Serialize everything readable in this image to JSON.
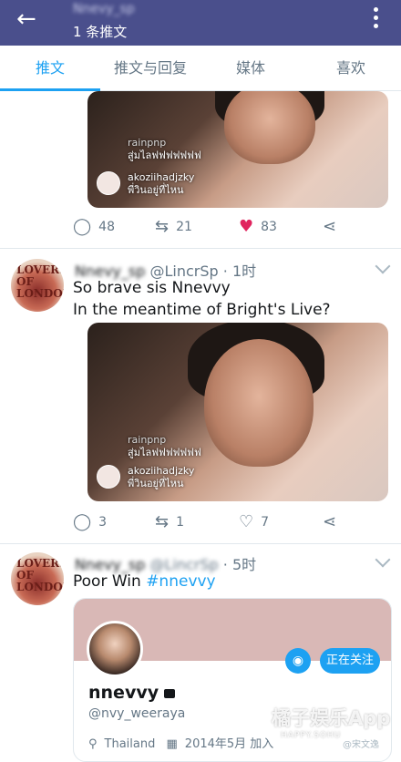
{
  "appbar": {
    "back_icon": "arrow-left-icon",
    "name": "Nnevy_sp",
    "subtitle": "1 条推文",
    "more_icon": "more-vertical-icon",
    "color": "#4a4f8c"
  },
  "tabs": [
    {
      "label": "推文",
      "active": true
    },
    {
      "label": "推文与回复",
      "active": false
    },
    {
      "label": "媒体",
      "active": false
    },
    {
      "label": "喜欢",
      "active": false
    }
  ],
  "accent": "#1da1f2",
  "tweet0": {
    "overlay_user": "rainpnp",
    "overlay_comment_user": "akoziihadjzky",
    "overlay_comment": "พี่วินอยู่ที่ไหน",
    "overlay_line1": "สู่มไลฟฟฟฟฟฟฟ",
    "replies": "48",
    "retweets": "21",
    "likes": "83",
    "liked": true
  },
  "tweet1": {
    "name": "Nnevy_sp",
    "handle": "@LincrSp",
    "time": "· 1时",
    "text_line1": "So brave sis Nnevvy",
    "text_line2": "In the meantime of Bright's Live?",
    "overlay_user": "rainpnp",
    "overlay_line1": "สู่มไลฟฟฟฟฟฟฟ",
    "overlay_comment_user": "akoziihadjzky",
    "overlay_comment": "พี่วินอยู่ที่ไหน",
    "replies": "3",
    "retweets": "1",
    "likes": "7"
  },
  "tweet2": {
    "name": "Nnevy_sp",
    "handle": "@LincrSp",
    "time": "· 5时",
    "text_prefix": "Poor Win ",
    "hashtag": "#nnevvy",
    "avatar_text": "LOVERS OF LONDON",
    "card": {
      "display_name": "nnevvy",
      "handle": "@nvy_weeraya",
      "location": "Thailand",
      "joined": "2014年5月 加入",
      "follow_label": "正在关注"
    }
  },
  "watermark": {
    "main": "橘子娱乐App",
    "sub": "HAPPY.SOHU",
    "corner": "@宋文逸"
  }
}
